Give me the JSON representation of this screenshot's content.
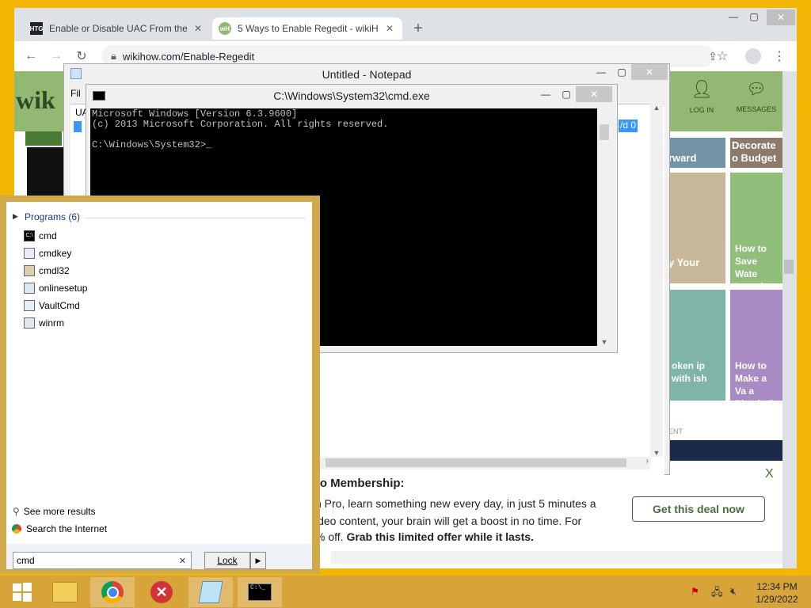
{
  "chrome": {
    "tabs": [
      {
        "favicon": "HTG",
        "title": "Enable or Disable UAC From the",
        "active": false
      },
      {
        "favicon": "wH",
        "title": "5 Ways to Enable Regedit - wikiH",
        "active": true
      }
    ],
    "new_tab": "+",
    "url": "wikihow.com/Enable-Regedit"
  },
  "wikihow": {
    "logo": "wik",
    "login": "LOG IN",
    "messages": "MESSAGES",
    "cards": [
      {
        "text": "rward"
      },
      {
        "text": "Decorate o Budget"
      },
      {
        "text": "y Your"
      },
      {
        "text": "How to Save Wate Laundry R"
      },
      {
        "text": "oken ip with ish"
      },
      {
        "text": "How to Make a Va a Plastic B"
      }
    ],
    "ad_label": "ENT",
    "promo_title": "ro Membership:",
    "promo_text1": "n Pro, learn something new every day, in just 5 minutes a",
    "promo_text2": "ideo content, your brain will get a boost in no time. For",
    "promo_text3": "% off. ",
    "promo_bold": "Grab this limited offer while it lasts.",
    "deal_button": "Get this deal now",
    "close": "X"
  },
  "notepad": {
    "title": "Untitled - Notepad",
    "menu_first": "Fil",
    "text_line1": "UA",
    "text_line2": "/d 0"
  },
  "cmd": {
    "title": "C:\\Windows\\System32\\cmd.exe",
    "line1": "Microsoft Windows [Version 6.3.9600]",
    "line2": "(c) 2013 Microsoft Corporation. All rights reserved.",
    "line3": "",
    "line4": "C:\\Windows\\System32>_"
  },
  "start": {
    "group": "Programs (6)",
    "programs": [
      {
        "name": "cmd",
        "icon": "cmd-icon"
      },
      {
        "name": "cmdkey",
        "icon": "window-icon"
      },
      {
        "name": "cmdl32",
        "icon": "tools-icon"
      },
      {
        "name": "onlinesetup",
        "icon": "setup-icon"
      },
      {
        "name": "VaultCmd",
        "icon": "window-icon"
      },
      {
        "name": "winrm",
        "icon": "setup-icon"
      }
    ],
    "see_more": "See more results",
    "search_internet": "Search the Internet",
    "search_value": "cmd",
    "lock_button": "Lock"
  },
  "taskbar": {
    "time": "12:34 PM",
    "date": "1/29/2022"
  }
}
